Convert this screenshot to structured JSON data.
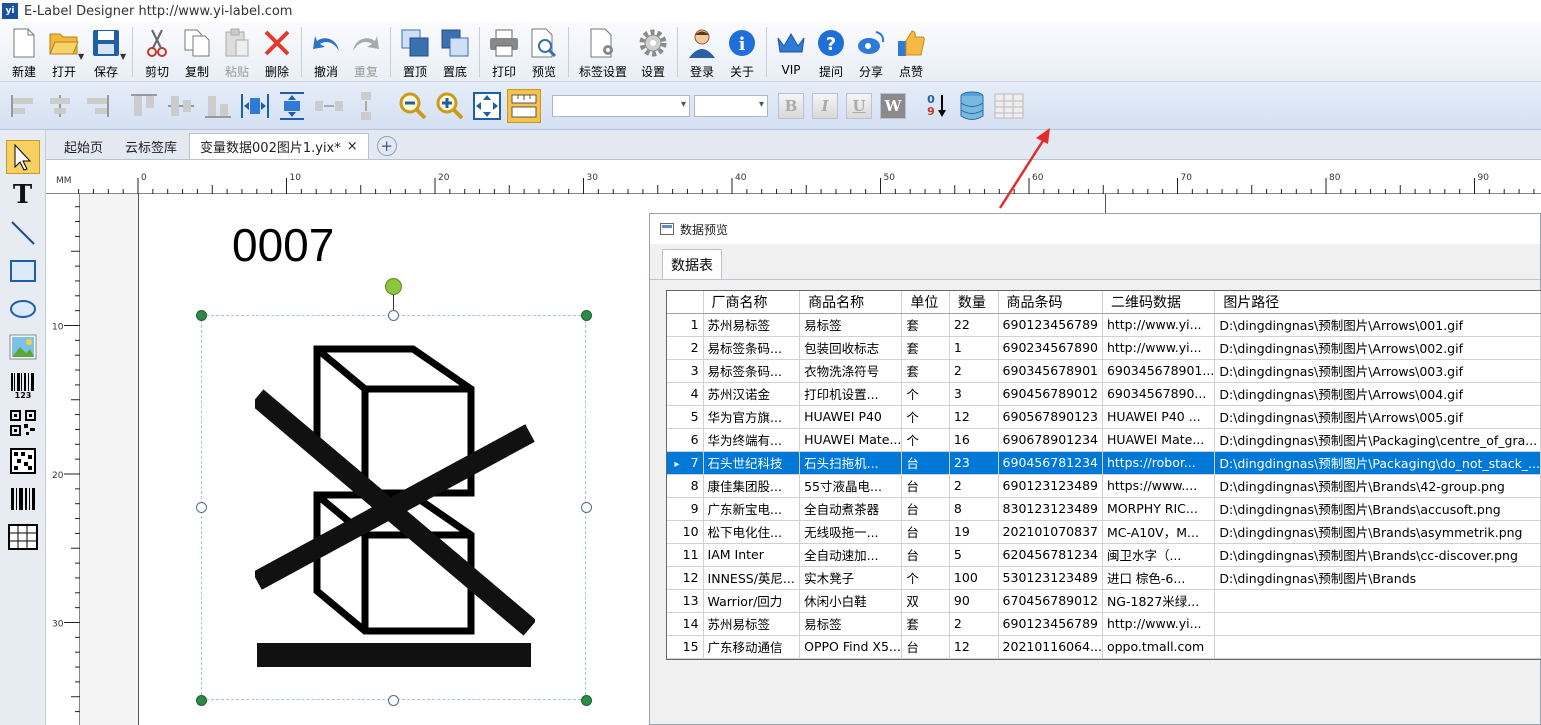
{
  "window": {
    "title": "E-Label Designer http://www.yi-label.com",
    "logo_text": "yi"
  },
  "toolbar": [
    {
      "label": "新建"
    },
    {
      "label": "打开"
    },
    {
      "label": "保存"
    },
    {
      "label": "剪切"
    },
    {
      "label": "复制"
    },
    {
      "label": "粘贴",
      "disabled": true
    },
    {
      "label": "删除"
    },
    {
      "label": "撤消"
    },
    {
      "label": "重复",
      "disabled": true
    },
    {
      "label": "置顶"
    },
    {
      "label": "置底"
    },
    {
      "label": "打印"
    },
    {
      "label": "预览"
    },
    {
      "label": "标签设置"
    },
    {
      "label": "设置"
    },
    {
      "label": "登录"
    },
    {
      "label": "关于"
    },
    {
      "label": "VIP"
    },
    {
      "label": "提问"
    },
    {
      "label": "分享"
    },
    {
      "label": "点赞"
    }
  ],
  "format_bar": {
    "bold": "B",
    "italic": "I",
    "underline": "U",
    "wrap": "W",
    "sort_top": "0",
    "sort_bottom": "9"
  },
  "tabs": [
    {
      "label": "起始页"
    },
    {
      "label": "云标签库"
    },
    {
      "label": "变量数据002图片1.yix*",
      "close": "×"
    }
  ],
  "tab_add": "+",
  "ruler": {
    "unit": "MM",
    "h_labels": [
      "0",
      "10",
      "20",
      "30",
      "40",
      "50",
      "60",
      "70",
      "80",
      "90"
    ],
    "v_labels": [
      "10",
      "20",
      "30"
    ]
  },
  "label": {
    "text": "0007"
  },
  "data_preview": {
    "title": "数据预览",
    "tab": "数据表",
    "columns": [
      "厂商名称",
      "商品名称",
      "单位",
      "数量",
      "商品条码",
      "二维码数据",
      "图片路径"
    ],
    "selected_row": 7,
    "rows": [
      [
        "1",
        "苏州易标签",
        "易标签",
        "套",
        "22",
        "690123456789",
        "http://www.yi...",
        "D:\\dingdingnas\\预制图片\\Arrows\\001.gif"
      ],
      [
        "2",
        "易标签条码...",
        "包装回收标志",
        "套",
        "1",
        "690234567890",
        "http://www.yi...",
        "D:\\dingdingnas\\预制图片\\Arrows\\002.gif"
      ],
      [
        "3",
        "易标签条码...",
        "衣物洗涤符号",
        "套",
        "2",
        "690345678901",
        "690345678901...",
        "D:\\dingdingnas\\预制图片\\Arrows\\003.gif"
      ],
      [
        "4",
        "苏州汉诺金",
        "打印机设置...",
        "个",
        "3",
        "690456789012",
        "69034567890...",
        "D:\\dingdingnas\\预制图片\\Arrows\\004.gif"
      ],
      [
        "5",
        "华为官方旗...",
        "HUAWEI P40",
        "个",
        "12",
        "690567890123",
        "HUAWEI P40 ...",
        "D:\\dingdingnas\\预制图片\\Arrows\\005.gif"
      ],
      [
        "6",
        "华为终端有...",
        "HUAWEI Mate...",
        "个",
        "16",
        "690678901234",
        "HUAWEI Mate...",
        "D:\\dingdingnas\\预制图片\\Packaging\\centre_of_gra..."
      ],
      [
        "7",
        "石头世纪科技",
        "石头扫拖机...",
        "台",
        "23",
        "690456781234",
        "https://robor...",
        "D:\\dingdingnas\\预制图片\\Packaging\\do_not_stack_..."
      ],
      [
        "8",
        "康佳集团股...",
        "55寸液晶电...",
        "台",
        "2",
        "690123123489",
        "https://www....",
        "D:\\dingdingnas\\预制图片\\Brands\\42-group.png"
      ],
      [
        "9",
        "广东新宝电...",
        "全自动煮茶器",
        "台",
        "8",
        "830123123489",
        "MORPHY RIC...",
        "D:\\dingdingnas\\预制图片\\Brands\\accusoft.png"
      ],
      [
        "10",
        "松下电化住...",
        "无线吸拖一...",
        "台",
        "19",
        "202101070837",
        "MC-A10V，M...",
        "D:\\dingdingnas\\预制图片\\Brands\\asymmetrik.png"
      ],
      [
        "11",
        "IAM Inter",
        "全自动速加...",
        "台",
        "5",
        "620456781234",
        "闽卫水字（...",
        "D:\\dingdingnas\\预制图片\\Brands\\cc-discover.png"
      ],
      [
        "12",
        "INNESS/英尼...",
        "实木凳子",
        "个",
        "100",
        "530123123489",
        "进口 棕色-6...",
        "D:\\dingdingnas\\预制图片\\Brands"
      ],
      [
        "13",
        "Warrior/回力",
        "休闲小白鞋",
        "双",
        "90",
        "670456789012",
        "NG-1827米绿...",
        ""
      ],
      [
        "14",
        "苏州易标签",
        "易标签",
        "套",
        "2",
        "690123456789",
        "http://www.yi...",
        ""
      ],
      [
        "15",
        "广东移动通信",
        "OPPO Find X5...",
        "台",
        "12",
        "20210116064...",
        "oppo.tmall.com",
        ""
      ]
    ]
  }
}
